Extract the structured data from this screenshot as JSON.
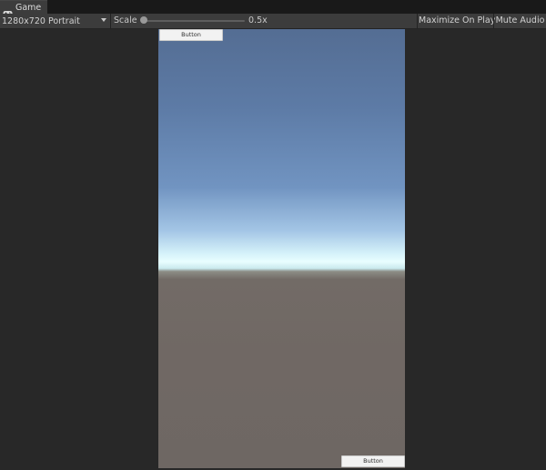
{
  "window": {
    "tab_label": "Game",
    "tab_icon": "gamepad-icon"
  },
  "toolbar": {
    "resolution": "1280x720 Portrait",
    "scale_label": "Scale",
    "scale_value": "0.5x",
    "scale_fraction": 0.0,
    "maximize_label": "Maximize On Play",
    "mute_label": "Mute Audio"
  },
  "game_view": {
    "top_button_label": "Button",
    "bottom_button_label": "Button"
  },
  "colors": {
    "editor_background": "#282828",
    "toolbar_background": "#3c3c3c",
    "sky_top": "#546d93",
    "horizon": "#e9feff",
    "ground": "#706864"
  }
}
